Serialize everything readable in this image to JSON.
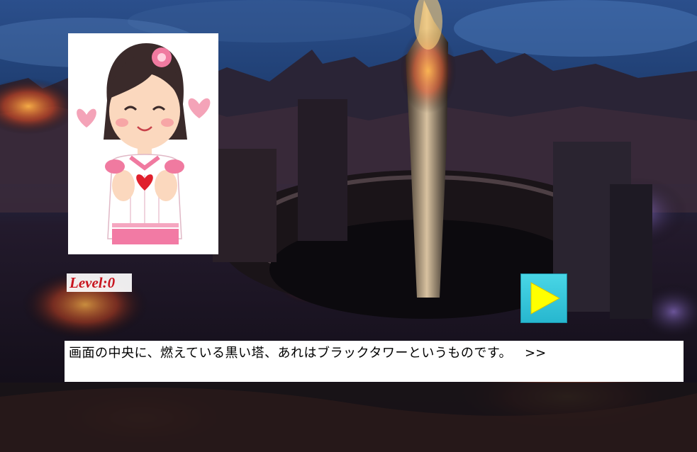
{
  "scene": {
    "description_icon": "dark-city-tower-background",
    "colors": {
      "sky": "#1c3a6b",
      "fire": "#e8602a",
      "lightning": "#8a5cff",
      "city": "#14101c"
    }
  },
  "hud": {
    "level_text": "Level:0",
    "level_color": "#c8141e"
  },
  "portrait": {
    "icon": "smiling-girl-with-hearts-portrait"
  },
  "play_button": {
    "icon": "play-triangle-icon",
    "bg_color": "#3cc8dc",
    "triangle_color": "#ffff00"
  },
  "dialog": {
    "text": "画面の中央に、燃えている黒い塔、あれはブラックタワーというものです。",
    "next_label": ">>"
  }
}
